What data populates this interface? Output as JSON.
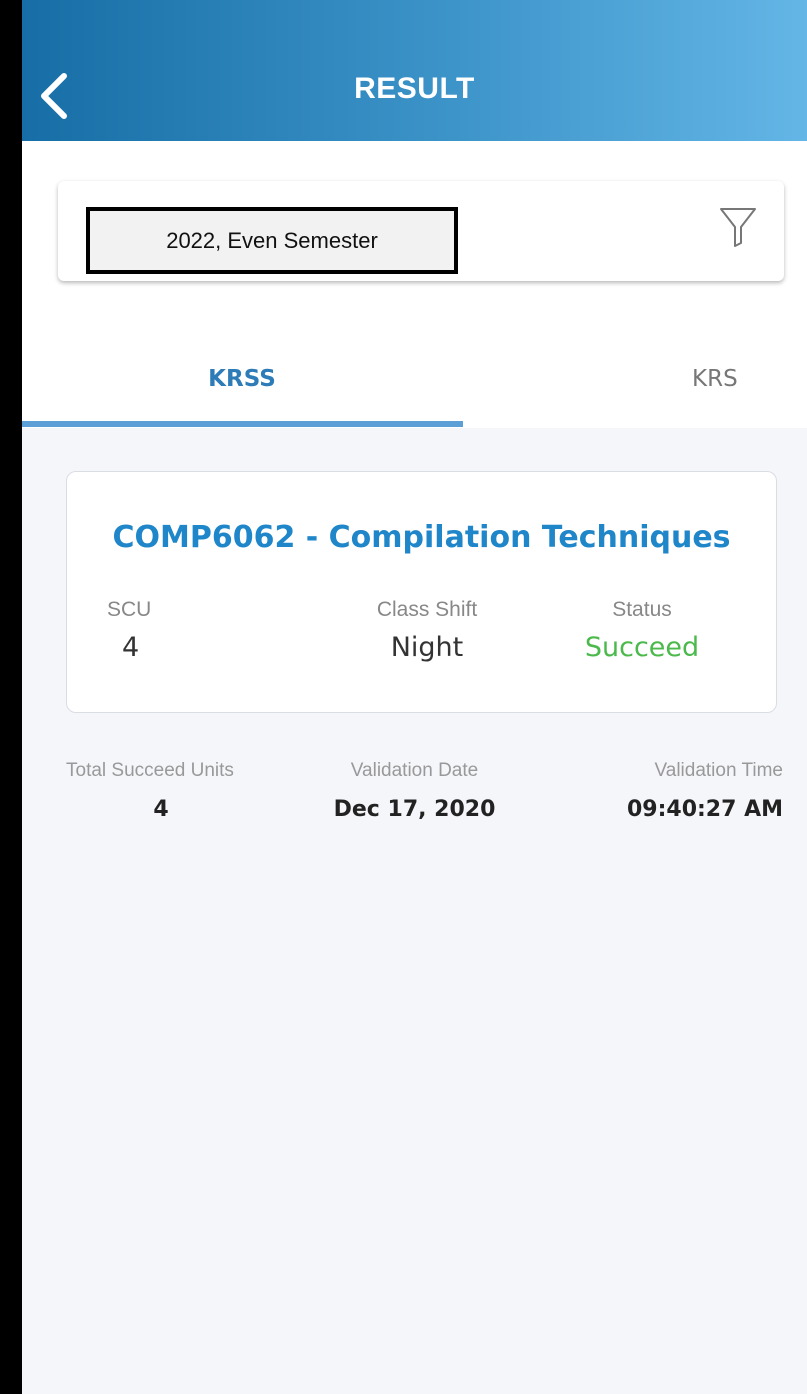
{
  "header": {
    "title": "RESULT",
    "back_icon": "chevron-left-icon"
  },
  "filter": {
    "semester": "2022, Even Semester",
    "filter_icon": "funnel-icon"
  },
  "tabs": [
    {
      "label": "KRSS",
      "active": true
    },
    {
      "label": "KRS",
      "active": false
    }
  ],
  "course": {
    "title": "COMP6062 - Compilation Techniques",
    "scu_label": "SCU",
    "scu_value": "4",
    "shift_label": "Class Shift",
    "shift_value": "Night",
    "status_label": "Status",
    "status_value": "Succeed"
  },
  "summary": {
    "units_label": "Total Succeed Units",
    "units_value": "4",
    "date_label": "Validation Date",
    "date_value": "Dec 17, 2020",
    "time_label": "Validation Time",
    "time_value": "09:40:27 AM"
  },
  "colors": {
    "accent": "#1e86c9",
    "success": "#4cb94c",
    "header_start": "#176ea6",
    "header_end": "#63b6e6"
  }
}
